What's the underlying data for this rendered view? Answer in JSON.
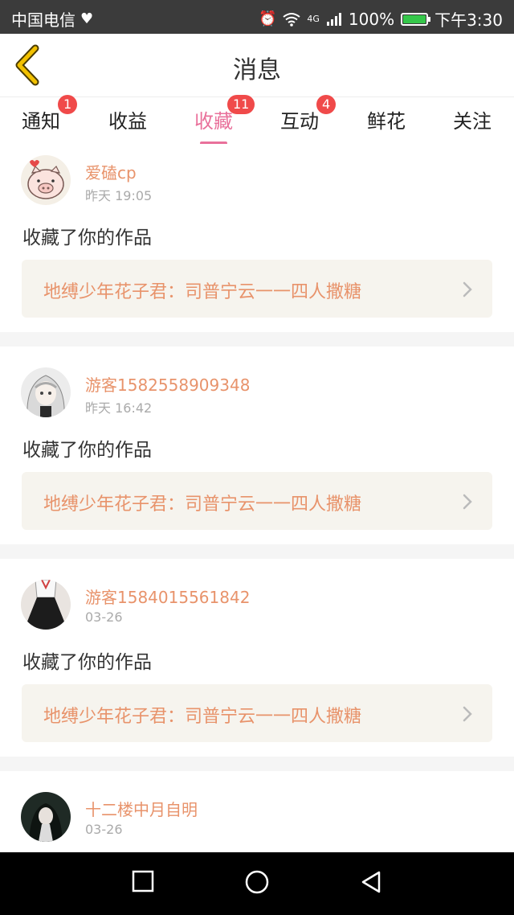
{
  "status_bar": {
    "carrier": "中国电信",
    "battery": "100%",
    "time": "下午3:30",
    "network": "4G",
    "battery_level": 1.0,
    "icons": [
      "heart-monitor-icon",
      "alarm-icon",
      "wifi-icon",
      "signal-icon",
      "battery-charging-icon"
    ]
  },
  "header": {
    "title": "消息",
    "back_icon": "chevron-left-icon",
    "accent": "#f2c100"
  },
  "tabs": [
    {
      "label": "通知",
      "badge": "1"
    },
    {
      "label": "收益",
      "badge": ""
    },
    {
      "label": "收藏",
      "badge": "11",
      "active": true
    },
    {
      "label": "互动",
      "badge": "4"
    },
    {
      "label": "鲜花",
      "badge": ""
    },
    {
      "label": "关注",
      "badge": ""
    }
  ],
  "colors": {
    "active_tab": "#e9719b",
    "badge": "#f04a4a",
    "name": "#e8936b"
  },
  "items": [
    {
      "user": "爱磕cp",
      "time": "昨天 19:05",
      "action": "收藏了你的作品",
      "work": "地缚少年花子君：司普宁云一一四人撒糖",
      "avatar": "pig-avatar"
    },
    {
      "user": "游客1582558909348",
      "time": "昨天 16:42",
      "action": "收藏了你的作品",
      "work": "地缚少年花子君：司普宁云一一四人撒糖",
      "avatar": "anime-girl-avatar"
    },
    {
      "user": "游客1584015561842",
      "time": "03-26",
      "action": "收藏了你的作品",
      "work": "地缚少年花子君：司普宁云一一四人撒糖",
      "avatar": "dress-avatar"
    },
    {
      "user": "十二楼中月自明",
      "time": "03-26",
      "action": "",
      "work": "",
      "avatar": "dark-portrait-avatar"
    }
  ],
  "nav": {
    "icons": [
      "recent-apps-icon",
      "home-icon",
      "back-icon"
    ]
  }
}
